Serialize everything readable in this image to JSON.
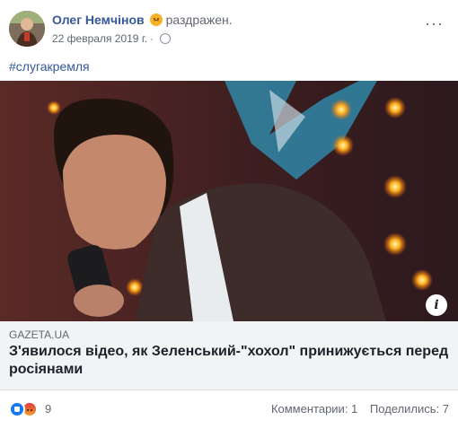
{
  "post": {
    "author": "Олег Немчінов",
    "feeling": "раздражен.",
    "date": "22 февраля 2019 г.",
    "separator": "·",
    "privacy_icon": "globe-icon",
    "more_label": "···",
    "text": "#слугакремля"
  },
  "link_preview": {
    "domain": "GAZETA.UA",
    "headline": "З'явилося відео, як Зеленський-\"хохол\" принижується перед росіянами",
    "info_label": "i"
  },
  "footer": {
    "reaction_count": "9",
    "comments": "Комментарии: 1",
    "shares": "Поделились: 7"
  },
  "colors": {
    "link_blue": "#385898",
    "like_blue": "#1877f2",
    "meta_gray": "#616770",
    "preview_bg": "#f2f3f5"
  }
}
